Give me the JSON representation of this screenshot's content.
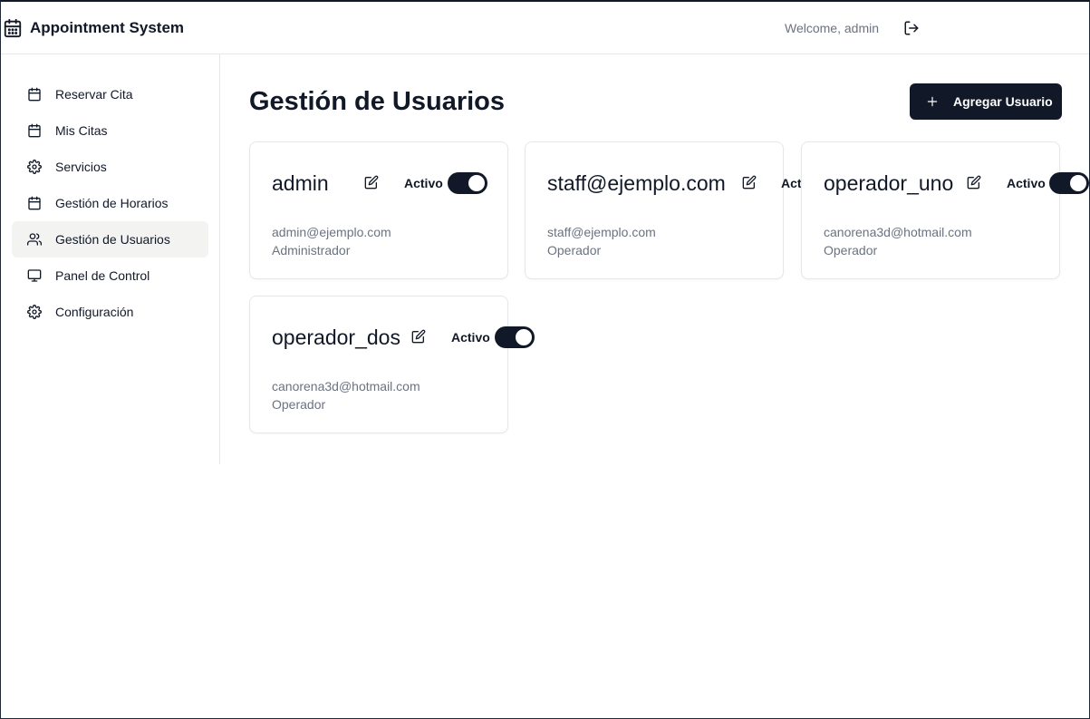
{
  "header": {
    "title": "Appointment System",
    "welcome": "Welcome, admin"
  },
  "sidebar": {
    "items": [
      {
        "label": "Reservar Cita",
        "icon": "calendar-icon"
      },
      {
        "label": "Mis Citas",
        "icon": "calendar-icon"
      },
      {
        "label": "Servicios",
        "icon": "gear-icon"
      },
      {
        "label": "Gestión de Horarios",
        "icon": "calendar-icon"
      },
      {
        "label": "Gestión de Usuarios",
        "icon": "users-icon",
        "active": true
      },
      {
        "label": "Panel de Control",
        "icon": "monitor-icon"
      },
      {
        "label": "Configuración",
        "icon": "gear-icon"
      }
    ]
  },
  "main": {
    "title": "Gestión de Usuarios",
    "add_button": "Agregar Usuario",
    "users": [
      {
        "name": "admin",
        "status": "Activo",
        "active": true,
        "email": "admin@ejemplo.com",
        "role": "Administrador"
      },
      {
        "name": "staff@ejemplo.com",
        "status": "Activo",
        "active": true,
        "email": "staff@ejemplo.com",
        "role": "Operador"
      },
      {
        "name": "operador_uno",
        "status": "Activo",
        "active": true,
        "email": "canorena3d@hotmail.com",
        "role": "Operador"
      },
      {
        "name": "operador_dos",
        "status": "Activo",
        "active": true,
        "email": "canorena3d@hotmail.com",
        "role": "Operador"
      }
    ]
  },
  "colors": {
    "primary": "#111827",
    "muted_text": "#6b7280",
    "border": "#e5e7eb",
    "active_nav_bg": "#f3f4f2"
  }
}
